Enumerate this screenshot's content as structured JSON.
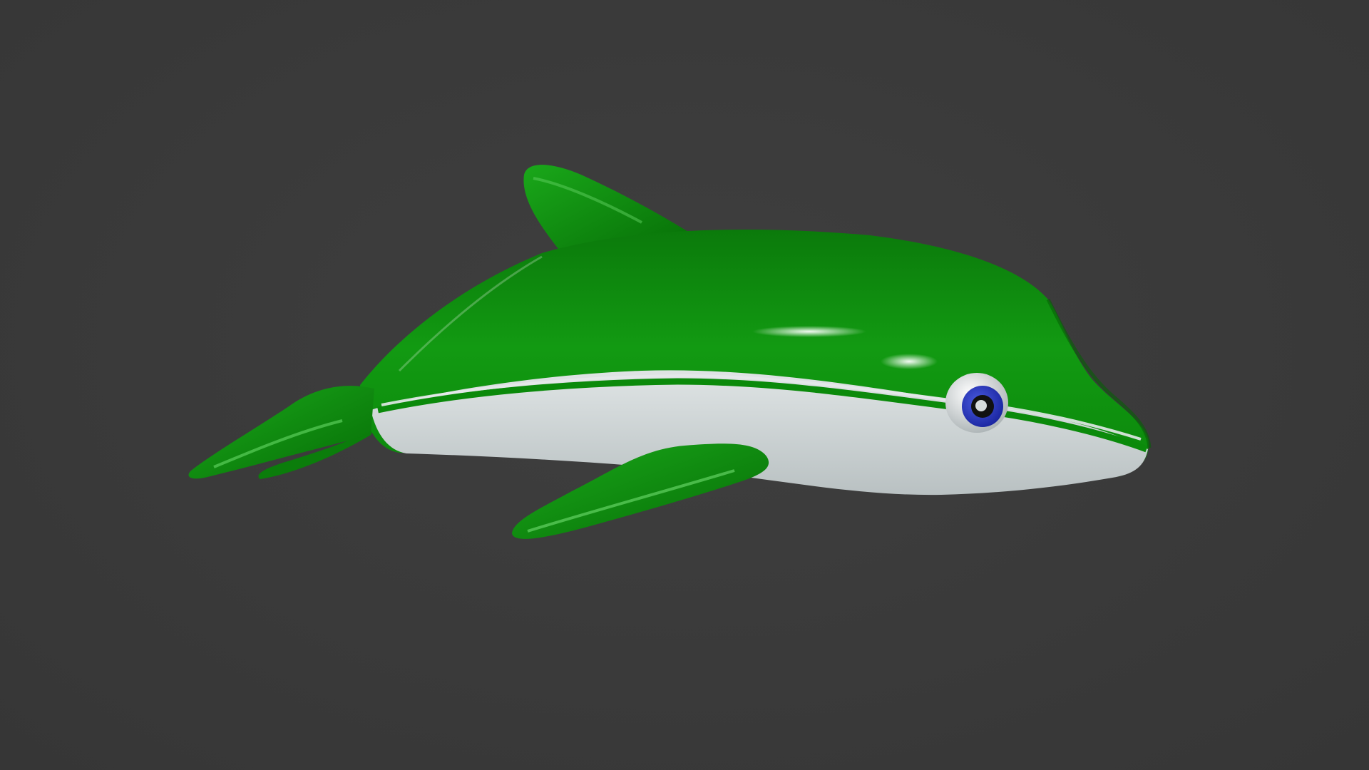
{
  "scene": {
    "subject_icon": "inflatable-dolphin",
    "colors": {
      "background": "#3b3b3b",
      "body_green": "#0a8a0a",
      "body_green_dark": "#056405",
      "belly_white": "#d4dadb",
      "eye_blue": "#1f2fb8",
      "pupil": "#111111"
    }
  }
}
